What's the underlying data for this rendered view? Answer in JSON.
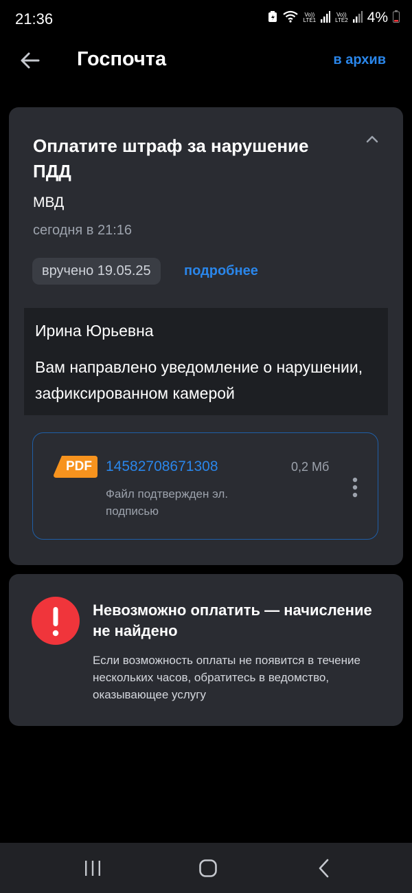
{
  "status_bar": {
    "time": "21:36",
    "lte1": "LTE1",
    "lte2": "LTE2",
    "vo": "Vo))",
    "battery": "4%"
  },
  "header": {
    "title": "Госпочта",
    "archive_label": "в архив"
  },
  "notice": {
    "title": "Оплатите штраф за нарушение ПДД",
    "sender": "МВД",
    "timestamp": "сегодня в 21:16",
    "delivered": "вручено 19.05.25",
    "details_label": "подробнее",
    "greeting": "Ирина Юрьевна",
    "message": "Вам направлено уведомление о нарушении, зафиксированном камерой",
    "file": {
      "type_label": "PDF",
      "name": "14582708671308",
      "size": "0,2 Мб",
      "subtitle": "Файл подтвержден эл. подписью"
    }
  },
  "payment_error": {
    "title": "Невозможно оплатить — начисление не найдено",
    "text": "Если возможность оплаты не появится в течение нескольких часов, обратитесь в ведомство, оказывающее услугу"
  },
  "colors": {
    "accent": "#2a86ea",
    "card": "#2a2c32",
    "error": "#f0353b",
    "pdf": "#f7931e"
  }
}
